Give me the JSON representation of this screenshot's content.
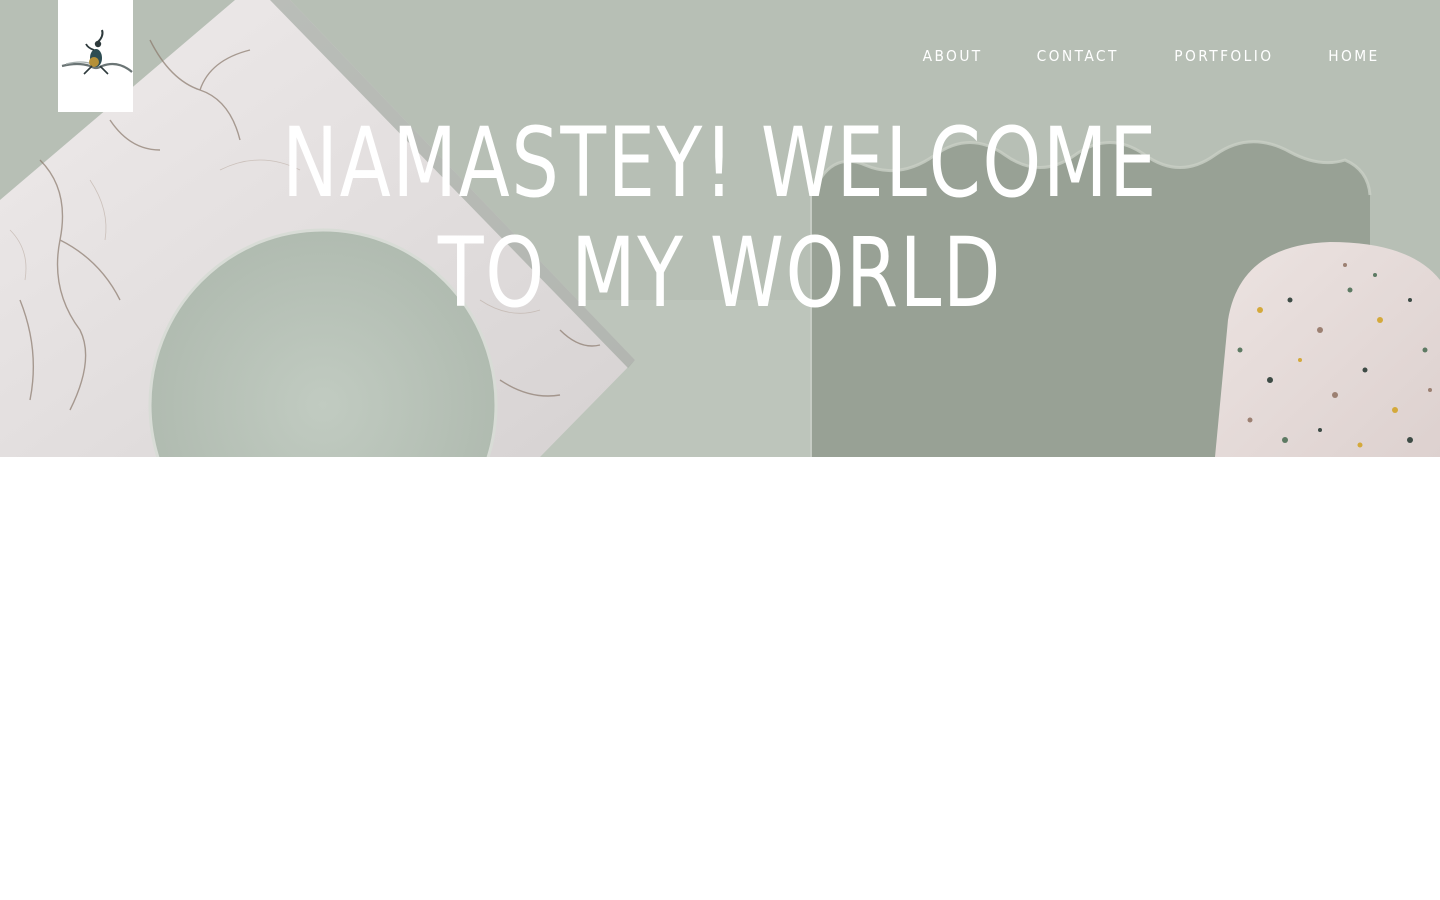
{
  "nav": {
    "items": [
      {
        "label": "ABOUT"
      },
      {
        "label": "CONTACT"
      },
      {
        "label": "PORTFOLIO"
      },
      {
        "label": "HOME"
      }
    ]
  },
  "hero": {
    "headline": "NAMASTEY! WELCOME TO MY WORLD"
  },
  "colors": {
    "hero_bg": "#b8c0b6",
    "marble": "#e8e4e4",
    "sage_panel": "#97a094",
    "text": "#ffffff"
  },
  "icons": {
    "logo": "dancer-logo-icon"
  }
}
